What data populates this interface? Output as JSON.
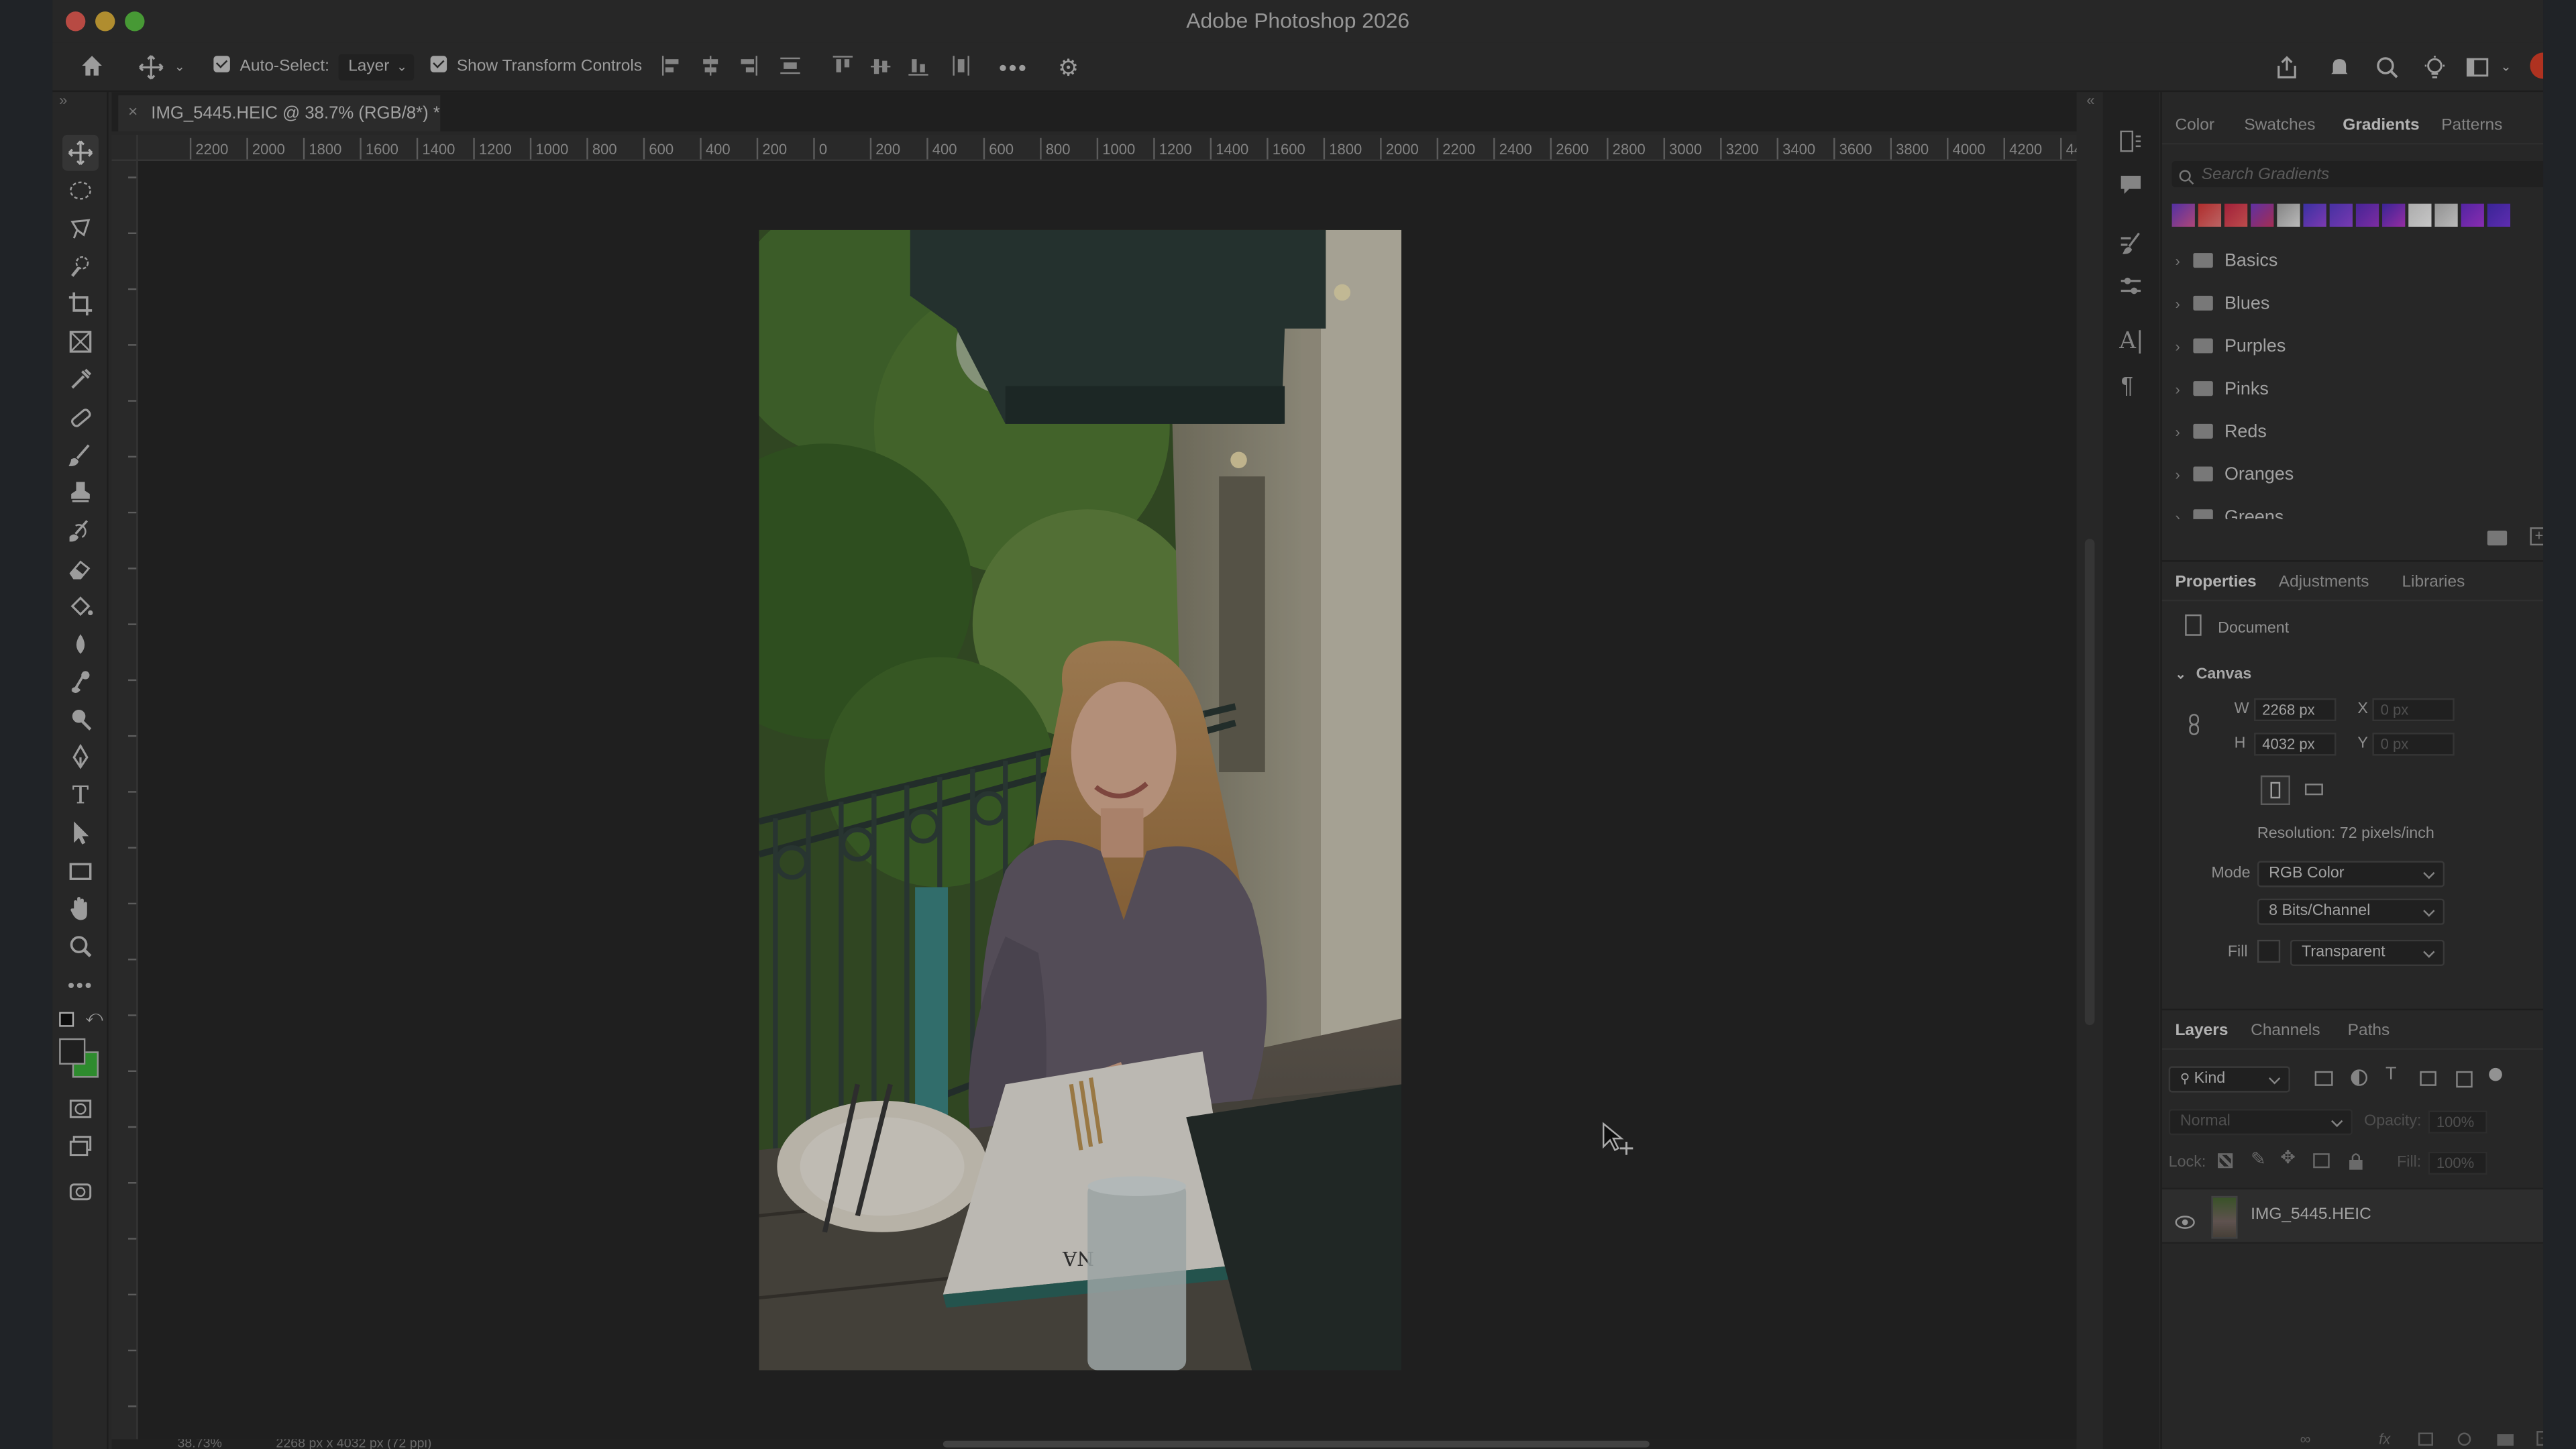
{
  "app": {
    "title": "Adobe Photoshop 2026"
  },
  "options_bar": {
    "auto_select_label": "Auto-Select:",
    "auto_select_value": "Layer",
    "show_transform_label": "Show Transform Controls"
  },
  "document_tab": {
    "title": "IMG_5445.HEIC @ 38.7% (RGB/8*) *"
  },
  "ruler": {
    "labels": [
      "2200",
      "2000",
      "1800",
      "1600",
      "1400",
      "1200",
      "1000",
      "800",
      "600",
      "400",
      "200",
      "0",
      "200",
      "400",
      "600",
      "800",
      "1000",
      "1200",
      "1400",
      "1600",
      "1800",
      "2000",
      "2200",
      "2400",
      "2600",
      "2800",
      "3000",
      "3200",
      "3400",
      "3600",
      "3800",
      "4000",
      "4200",
      "44"
    ]
  },
  "gradients_panel": {
    "tabs": [
      "Color",
      "Swatches",
      "Gradients",
      "Patterns"
    ],
    "active_tab": "Gradients",
    "search_placeholder": "Search Gradients",
    "folders": [
      "Basics",
      "Blues",
      "Purples",
      "Pinks",
      "Reds",
      "Oranges",
      "Greens"
    ]
  },
  "properties_panel": {
    "tabs": [
      "Properties",
      "Adjustments",
      "Libraries"
    ],
    "active_tab": "Properties",
    "doc_label": "Document",
    "canvas_section": "Canvas",
    "w_label": "W",
    "w_value": "2268 px",
    "h_label": "H",
    "h_value": "4032 px",
    "x_label": "X",
    "x_value": "0 px",
    "y_label": "Y",
    "y_value": "0 px",
    "resolution": "Resolution: 72 pixels/inch",
    "mode_label": "Mode",
    "mode_value": "RGB Color",
    "bits_value": "8 Bits/Channel",
    "fill_label": "Fill",
    "fill_value": "Transparent"
  },
  "layers_panel": {
    "tabs": [
      "Layers",
      "Channels",
      "Paths"
    ],
    "active_tab": "Layers",
    "kind_label": "Kind",
    "blend_mode": "Normal",
    "opacity_label": "Opacity:",
    "opacity_value": "100%",
    "lock_label": "Lock:",
    "fill_label": "Fill:",
    "fill_value": "100%",
    "layer_name": "IMG_5445.HEIC"
  },
  "status_bar": {
    "zoom": "38.73%",
    "doc_info": "2268 px x 4032 px (72 ppi)"
  },
  "colors": {
    "fg": "#2a2a2a",
    "bg": "#3bb33b",
    "accent": "#4a90e2"
  },
  "photo": {
    "menu_text": "NA"
  }
}
